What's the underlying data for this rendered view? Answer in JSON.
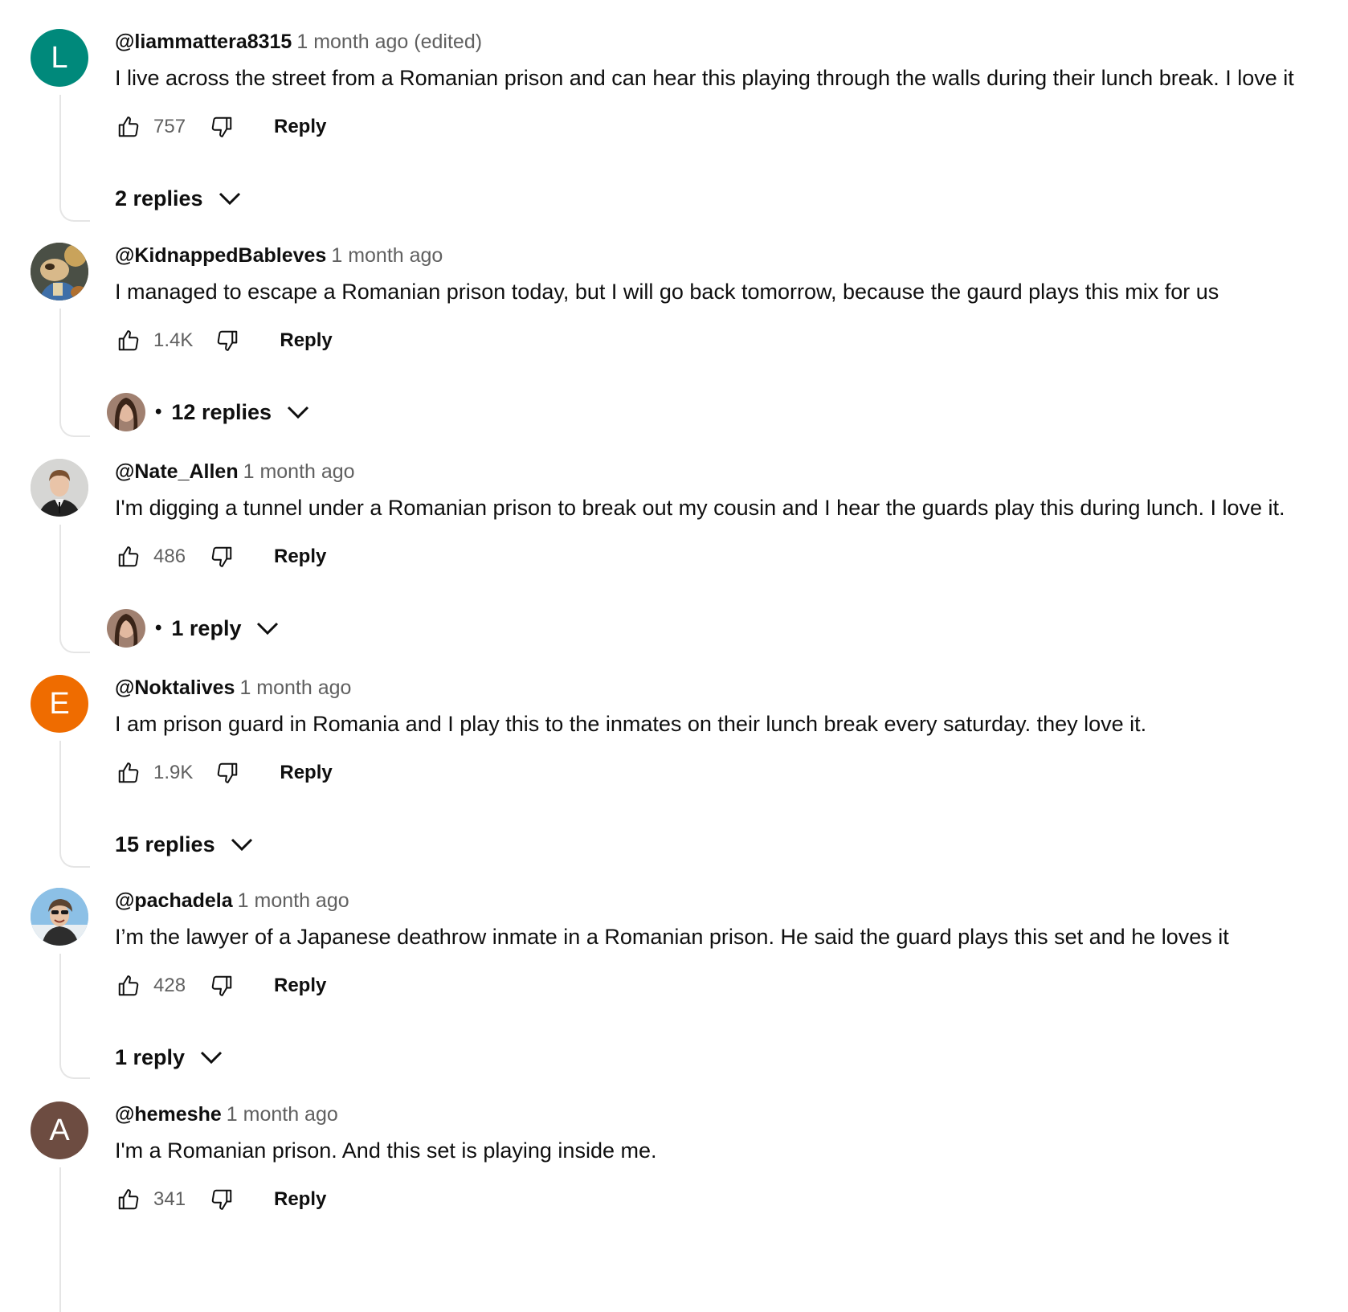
{
  "comments": [
    {
      "author": "@liammattera8315",
      "time": "1 month ago (edited)",
      "text": "I live across the street from a Romanian prison and can hear this playing through the walls during their lunch break. I love it",
      "likes": "757",
      "reply_label": "Reply",
      "replies_label": "2 replies",
      "avatar_letter": "L",
      "avatar_color": "#00897b"
    },
    {
      "author": "@KidnappedBableves",
      "time": "1 month ago",
      "text": "I managed to escape a Romanian prison today, but I will go back tomorrow, because the gaurd plays this mix for us",
      "likes": "1.4K",
      "reply_label": "Reply",
      "replies_label": "12 replies",
      "replies_bullet": "•",
      "avatar_letter": "",
      "avatar_color": "#6b5a3a"
    },
    {
      "author": "@Nate_Allen",
      "time": "1 month ago",
      "text": "I'm digging a tunnel under a Romanian prison to break out my cousin and I hear the guards play this during lunch. I love it.",
      "likes": "486",
      "reply_label": "Reply",
      "replies_label": "1 reply",
      "replies_bullet": "•",
      "avatar_letter": "",
      "avatar_color": "#cfcfcf"
    },
    {
      "author": "@Noktalives",
      "time": "1 month ago",
      "text": "I am prison guard in Romania and I play this to the inmates on their lunch break every saturday. they love it.",
      "likes": "1.9K",
      "reply_label": "Reply",
      "replies_label": "15 replies",
      "avatar_letter": "E",
      "avatar_color": "#ef6c00"
    },
    {
      "author": "@pachadela",
      "time": "1 month ago",
      "text": "I’m the lawyer of a Japanese deathrow inmate in a Romanian prison. He said the guard plays this set and he loves it",
      "likes": "428",
      "reply_label": "Reply",
      "replies_label": "1 reply",
      "avatar_letter": "",
      "avatar_color": "#8fb8d8"
    },
    {
      "author": "@hemeshe",
      "time": "1 month ago",
      "text": "I'm a Romanian prison. And this set is playing inside me.",
      "likes": "341",
      "reply_label": "Reply",
      "avatar_letter": "A",
      "avatar_color": "#6d4c41"
    }
  ]
}
